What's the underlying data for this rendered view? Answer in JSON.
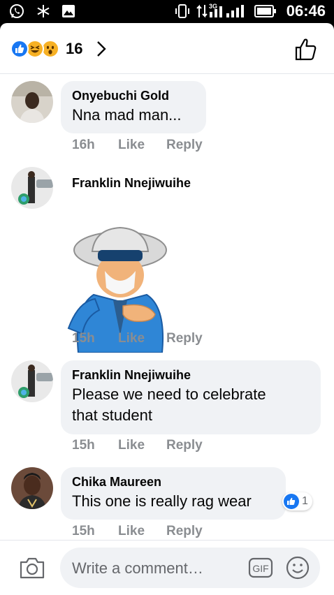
{
  "status_bar": {
    "network_type": "3G",
    "time": "06:46",
    "icons": [
      "whatsapp-icon",
      "snowflake-icon",
      "gallery-icon",
      "vibrate-icon",
      "data-arrows-icon",
      "signal-icon",
      "battery-icon"
    ]
  },
  "header": {
    "reactions": [
      "like",
      "haha",
      "wow"
    ],
    "reaction_count": "16",
    "icons": [
      "chevron-right-icon",
      "thumbs-up-outline-icon"
    ]
  },
  "comments": [
    {
      "author": "Onyebuchi Gold",
      "text": "Nna mad man...",
      "time": "16h",
      "like": "Like",
      "reply": "Reply"
    },
    {
      "author": "Franklin Nnejiwuihe",
      "text": "",
      "sticker": "sticker-man-in-blue-jacket",
      "time": "15h",
      "like": "Like",
      "reply": "Reply"
    },
    {
      "author": "Franklin Nnejiwuihe",
      "text_line1": "Please we need to celebrate",
      "text_line2": "that student",
      "time": "15h",
      "like": "Like",
      "reply": "Reply"
    },
    {
      "author": "Chika Maureen",
      "text": "This one is really  rag wear",
      "time": "15h",
      "like": "Like",
      "reply": "Reply",
      "reaction_count": "1"
    }
  ],
  "composer": {
    "placeholder": "Write a comment…",
    "gif_label": "GIF",
    "icons": [
      "camera-icon",
      "gif-icon",
      "emoji-icon"
    ]
  },
  "colors": {
    "like_blue": "#1877f2",
    "haha_yellow": "#f7b125",
    "bubble_grey": "#f0f2f5",
    "meta_grey": "#8a8d91"
  }
}
